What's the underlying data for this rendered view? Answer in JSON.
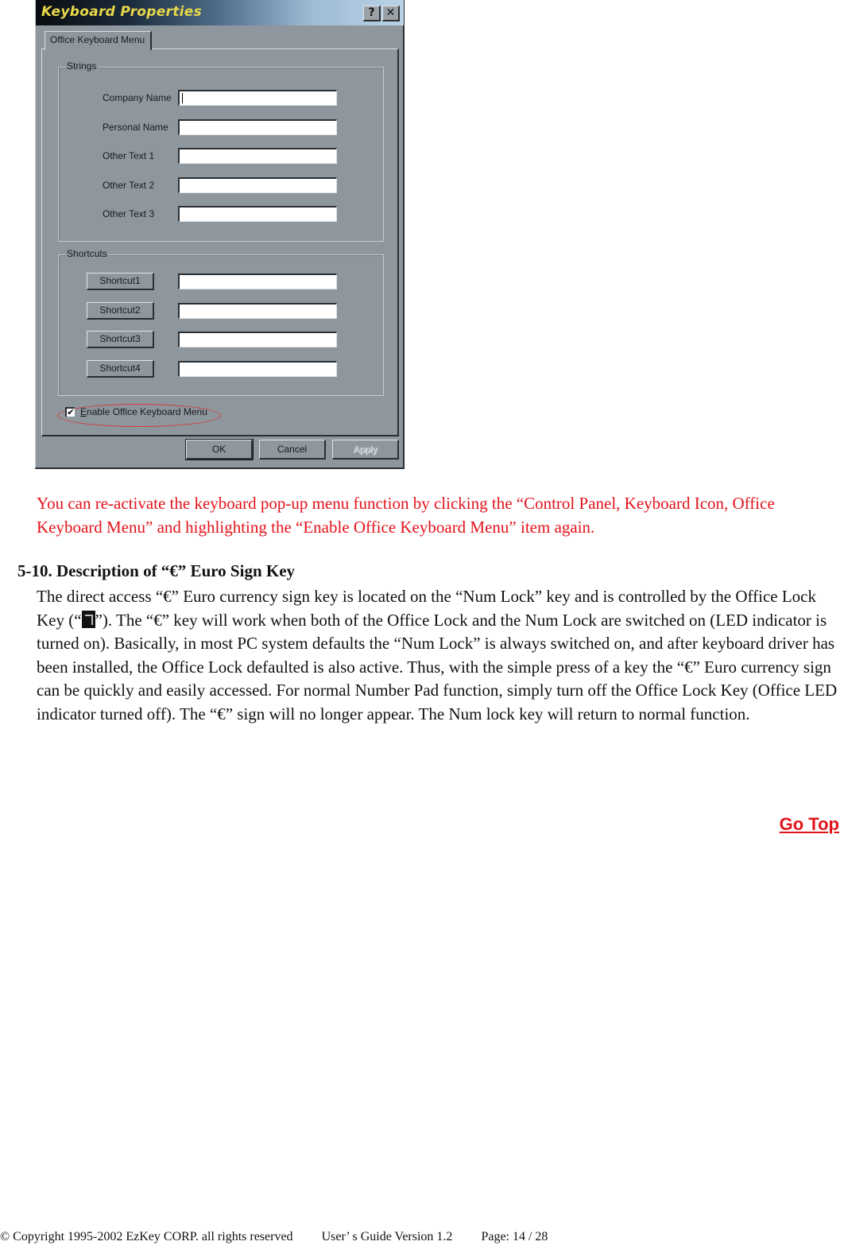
{
  "dialog": {
    "title": "Keyboard Properties",
    "help_button": "?",
    "close_button": "✕",
    "tab": "Office Keyboard Menu",
    "strings_group": {
      "legend": "Strings",
      "fields": [
        {
          "label": "Company Name",
          "value": ""
        },
        {
          "label": "Personal Name",
          "value": ""
        },
        {
          "label": "Other Text 1",
          "value": ""
        },
        {
          "label": "Other Text 2",
          "value": ""
        },
        {
          "label": "Other Text 3",
          "value": ""
        }
      ]
    },
    "shortcuts_group": {
      "legend": "Shortcuts",
      "items": [
        {
          "button": "Shortcut1",
          "value": ""
        },
        {
          "button": "Shortcut2",
          "value": ""
        },
        {
          "button": "Shortcut3",
          "value": ""
        },
        {
          "button": "Shortcut4",
          "value": ""
        }
      ]
    },
    "enable_checkbox": {
      "mnemonic": "E",
      "label_rest": "nable Office Keyboard Menu",
      "checked": true,
      "check_glyph": "✔"
    },
    "buttons": {
      "ok": "OK",
      "cancel": "Cancel",
      "apply": "Apply"
    },
    "highlight_color": "#d63a3a"
  },
  "document": {
    "note": "You can re-activate the keyboard pop-up menu function by clicking the “Control Panel, Keyboard Icon, Office Keyboard Menu” and highlighting the “Enable Office Keyboard Menu” item again.",
    "note_color": "#e3131b",
    "section_heading": "5-10. Description of “€” Euro Sign Key",
    "body_before_icon": "The direct access “€” Euro currency sign key is located on the “Num Lock” key and is controlled by the Office Lock Key (“",
    "body_icon": "office-lock-key-icon",
    "body_after_icon": "”). The “€” key will work when both of the Office Lock and the Num Lock are switched on (LED indicator is turned on). Basically, in most PC system defaults the “Num Lock” is always switched on, and after keyboard driver has been installed, the Office Lock defaulted is also active. Thus, with the simple press of a key the “€” Euro currency sign can be quickly and easily accessed. For normal Number Pad function, simply turn off the Office Lock Key (Office LED indicator turned off). The “€” sign will no longer appear. The Num lock key will return to normal function.",
    "go_top": "Go Top"
  },
  "footer": {
    "copyright": "© Copyright 1995-2002 EzKey CORP. all rights reserved",
    "guide": "User’ s  Guide  Version  1.2",
    "page": "Page:  14 / 28"
  }
}
